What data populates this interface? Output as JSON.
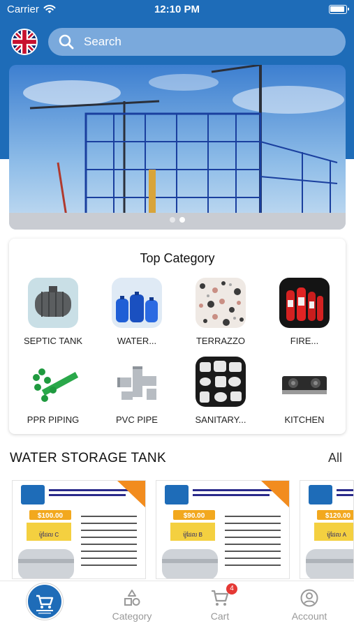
{
  "status_bar": {
    "carrier": "Carrier",
    "time": "12:10 PM"
  },
  "header": {
    "language_flag": "uk-flag-icon",
    "search_placeholder": "Search"
  },
  "banner": {
    "slides": 2,
    "active_slide": 1
  },
  "top_category": {
    "title": "Top Category",
    "items": [
      {
        "label": "SEPTIC TANK"
      },
      {
        "label": "WATER..."
      },
      {
        "label": "TERRAZZO"
      },
      {
        "label": "FIRE..."
      },
      {
        "label": "PPR PIPING"
      },
      {
        "label": "PVC PIPE"
      },
      {
        "label": "SANITARY..."
      },
      {
        "label": "KITCHEN"
      }
    ]
  },
  "section": {
    "title": "WATER STORAGE TANK",
    "all_label": "All"
  },
  "products": [
    {
      "price": "$100.00",
      "model": "ម៉ូដែល C"
    },
    {
      "price": "$90.00",
      "model": "ម៉ូដែល B"
    },
    {
      "price": "$120.00",
      "model": "ម៉ូដែល A"
    }
  ],
  "tab_bar": {
    "items": [
      {
        "label": ""
      },
      {
        "label": "Category"
      },
      {
        "label": "Cart"
      },
      {
        "label": "Account"
      }
    ],
    "cart_badge": "4"
  },
  "colors": {
    "brand_blue": "#1e6cb8",
    "badge_red": "#e53935"
  }
}
